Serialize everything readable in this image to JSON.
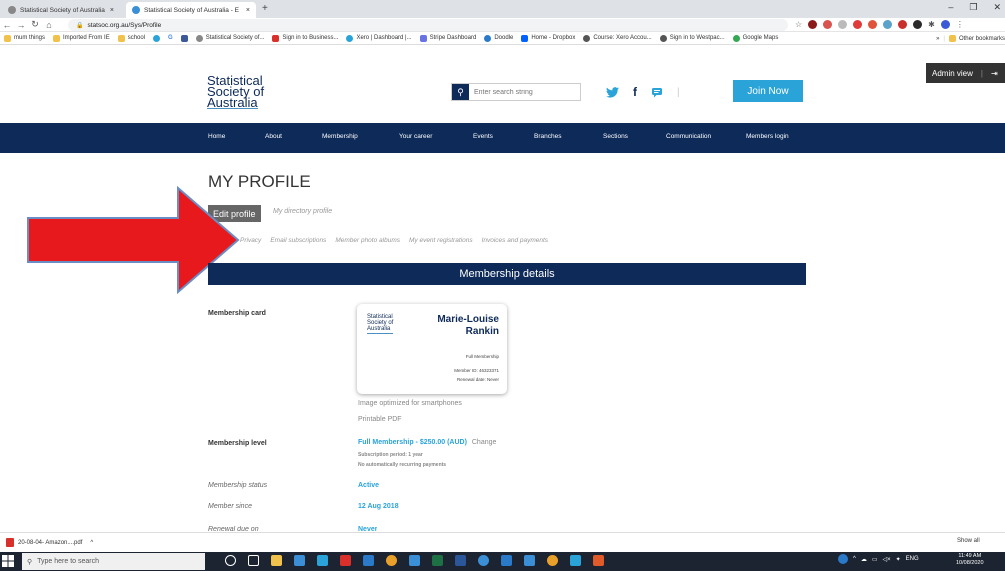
{
  "browser": {
    "tabs": [
      {
        "title": "Statistical Society of Australia - E",
        "active": false
      },
      {
        "title": "Statistical Society of Australia - E",
        "active": true
      }
    ],
    "url": "statsoc.org.au/Sys/Profile",
    "bookmarks": [
      "mum things",
      "Imported From IE",
      "school",
      "G",
      "Statistical Society of...",
      "Sign in to Business...",
      "Xero | Dashboard |...",
      "Stripe Dashboard",
      "Doodle",
      "Home - Dropbox",
      "Course: Xero Accou...",
      "Sign in to Westpac...",
      "Google Maps"
    ],
    "bookmarks_more": "»",
    "other_bookmarks": "Other bookmarks"
  },
  "admin": {
    "label": "Admin view"
  },
  "header": {
    "logo_lines": [
      "Statistical",
      "Society of",
      "Australia"
    ],
    "search_placeholder": "Enter search string",
    "join_label": "Join Now"
  },
  "nav": [
    "Home",
    "About",
    "Membership",
    "Your career",
    "Events",
    "Branches",
    "Sections",
    "Communication",
    "Members login"
  ],
  "page": {
    "title": "MY PROFILE",
    "tabs": [
      "Edit profile",
      "My directory profile"
    ],
    "subtabs": [
      "Privacy",
      "Email subscriptions",
      "Member photo albums",
      "My event registrations",
      "Invoices and payments"
    ],
    "section_title": "Membership details"
  },
  "membership": {
    "card_label": "Membership card",
    "card": {
      "logo_lines": [
        "Statistical",
        "Society of",
        "Australia"
      ],
      "first_name": "Marie-Louise",
      "last_name": "Rankin",
      "type": "Full Membership",
      "member_id": "Member ID: 46323371",
      "renewal": "Renewal date: Never"
    },
    "image_opt": "Image optimized for smartphones",
    "printable": "Printable PDF",
    "level_label": "Membership level",
    "level_value": "Full Membership - $250.00 (AUD)",
    "level_change": "Change",
    "subscription_period": "Subscription period: 1 year",
    "recurring": "No automatically recurring payments",
    "status_label": "Membership status",
    "status_value": "Active",
    "since_label": "Member since",
    "since_value": "12 Aug 2018",
    "renewal_label": "Renewal due on",
    "renewal_value": "Never"
  },
  "downloads": {
    "file": "20-08-04- Amazon....pdf",
    "show_all": "Show all"
  },
  "taskbar": {
    "search_placeholder": "Type here to search",
    "lang": "ENG",
    "time": "11:49 AM",
    "date": "10/08/2020"
  }
}
